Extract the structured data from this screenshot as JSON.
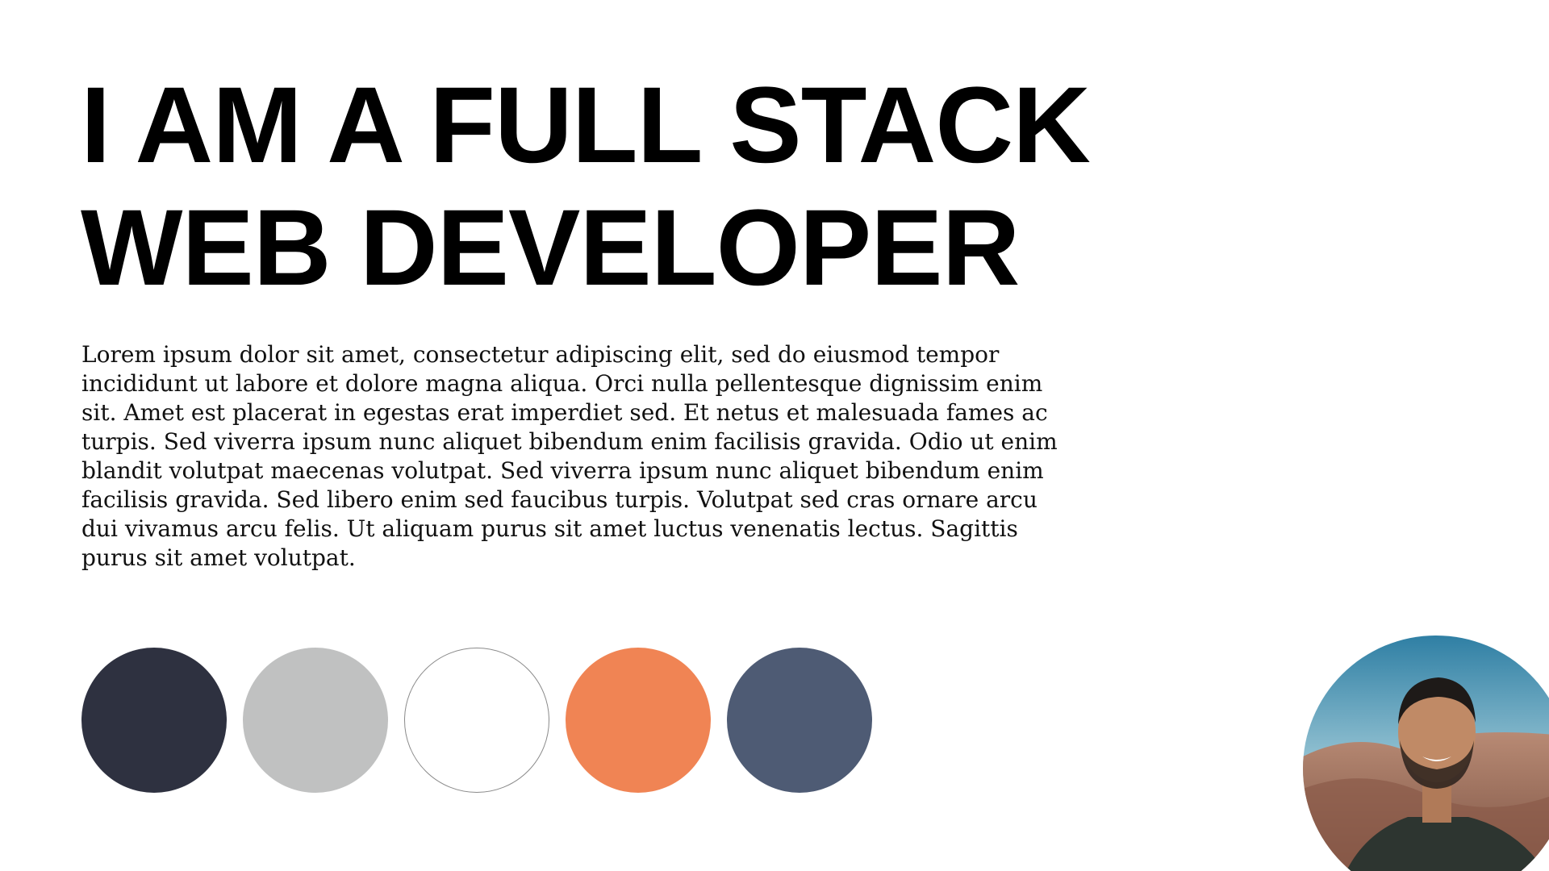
{
  "hero": {
    "title_line1": "I AM A FULL STACK",
    "title_line2": "WEB DEVELOPER"
  },
  "intro": {
    "text": "Lorem ipsum dolor sit amet, consectetur adipiscing elit, sed do eiusmod tempor incididunt ut labore et dolore magna aliqua. Orci nulla pellentesque dignissim enim sit. Amet est placerat in egestas erat imperdiet sed. Et netus et malesuada fames ac turpis. Sed viverra ipsum nunc aliquet bibendum enim facilisis gravida. Odio ut enim blandit volutpat maecenas volutpat. Sed viverra ipsum nunc aliquet bibendum enim facilisis gravida. Sed libero enim sed faucibus turpis. Volutpat sed cras ornare arcu dui vivamus arcu felis. Ut aliquam purus sit amet luctus venenatis lectus. Sagittis purus sit amet volutpat."
  },
  "palette": [
    {
      "color": "#2e3140",
      "outlined": false
    },
    {
      "color": "#c0c1c1",
      "outlined": false
    },
    {
      "color": "#ffffff",
      "outlined": true
    },
    {
      "color": "#f08454",
      "outlined": false
    },
    {
      "color": "#4e5b74",
      "outlined": false
    }
  ],
  "avatar": {
    "icon": "profile-photo",
    "colors": {
      "sky": "#5f9fba",
      "dune": "#a0705a",
      "shirt": "#2d3530",
      "skin": "#c08a66",
      "hair": "#1e1a18"
    }
  }
}
